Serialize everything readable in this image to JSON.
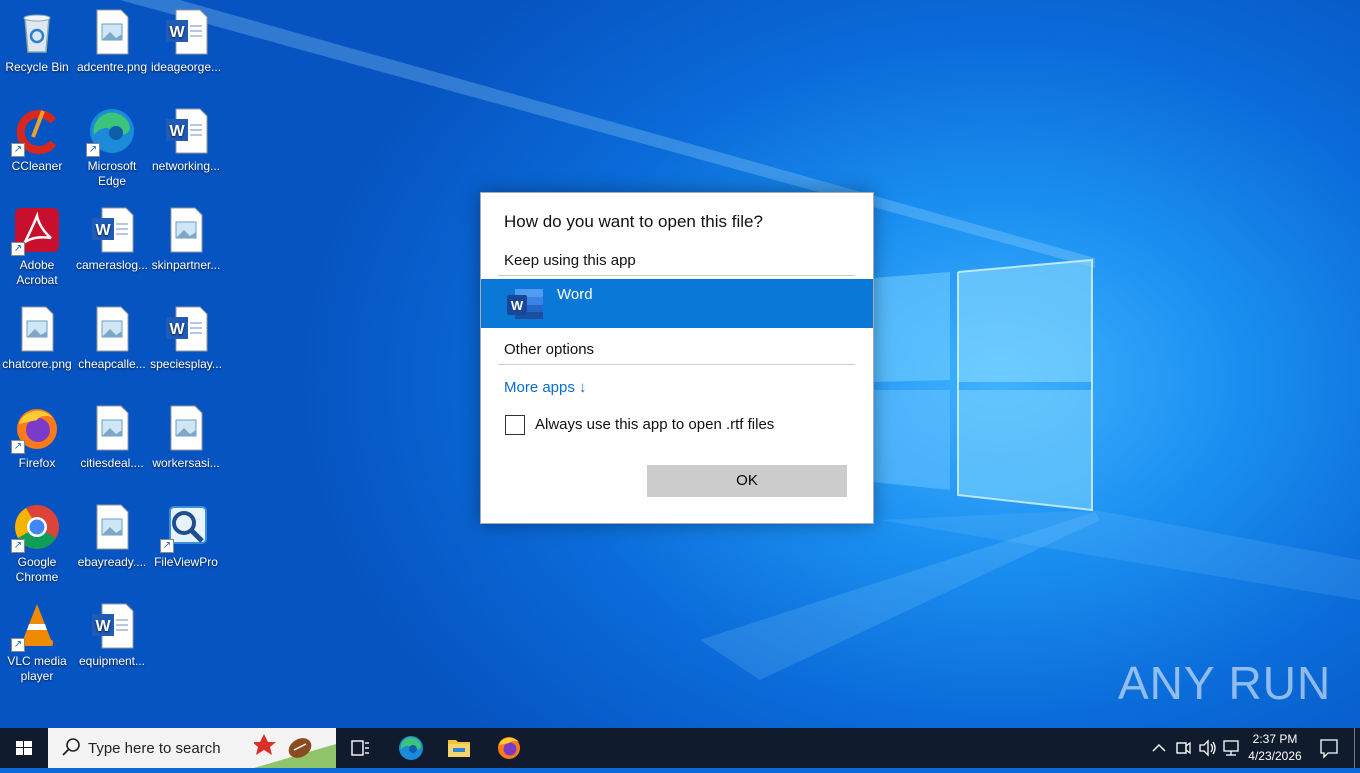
{
  "desktop": {
    "icons": [
      {
        "label": "Recycle Bin",
        "icon": "recycle-bin-icon"
      },
      {
        "label": "adcentre.png",
        "icon": "image-file-icon"
      },
      {
        "label": "ideageorge...",
        "icon": "word-document-icon"
      },
      {
        "label": "CCleaner",
        "icon": "ccleaner-icon"
      },
      {
        "label": "Microsoft Edge",
        "icon": "edge-icon"
      },
      {
        "label": "networking...",
        "icon": "word-document-icon"
      },
      {
        "label": "Adobe Acrobat",
        "icon": "acrobat-icon"
      },
      {
        "label": "cameraslog...",
        "icon": "word-document-icon"
      },
      {
        "label": "skinpartner...",
        "icon": "image-file-icon"
      },
      {
        "label": "chatcore.png",
        "icon": "image-file-icon"
      },
      {
        "label": "cheapcalle...",
        "icon": "image-file-icon"
      },
      {
        "label": "speciesplay...",
        "icon": "word-document-icon"
      },
      {
        "label": "Firefox",
        "icon": "firefox-icon"
      },
      {
        "label": "citiesdeal....",
        "icon": "image-file-icon"
      },
      {
        "label": "workersasi...",
        "icon": "image-file-icon"
      },
      {
        "label": "Google Chrome",
        "icon": "chrome-icon"
      },
      {
        "label": "ebayready....",
        "icon": "image-file-icon"
      },
      {
        "label": "FileViewPro",
        "icon": "fileviewpro-icon"
      },
      {
        "label": "VLC media player",
        "icon": "vlc-icon"
      },
      {
        "label": "equipment...",
        "icon": "word-document-icon"
      }
    ],
    "watermark": "ANY RUN"
  },
  "dialog": {
    "title": "How do you want to open this file?",
    "keep_using_label": "Keep using this app",
    "selected_app": {
      "name": "Word",
      "icon": "word-app-icon"
    },
    "other_options_label": "Other options",
    "more_apps_label": "More apps ↓",
    "always_use_label": "Always use this app to open .rtf files",
    "always_use_checked": false,
    "ok_label": "OK",
    "accent_color": "#0a78d7"
  },
  "taskbar": {
    "search_placeholder": "Type here to search",
    "pinned": [
      "task-view-icon",
      "edge-icon",
      "file-explorer-icon",
      "firefox-icon"
    ],
    "clock_time": "2:37 PM",
    "clock_date": "4/23/2026"
  }
}
